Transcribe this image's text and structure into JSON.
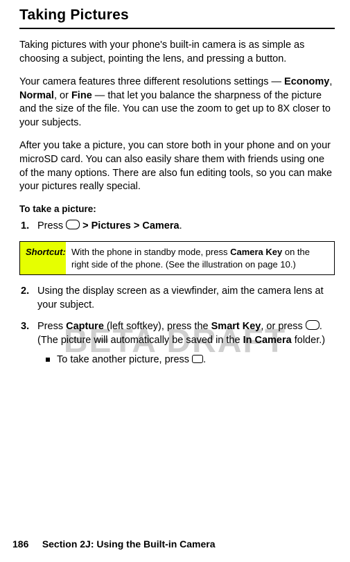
{
  "title": "Taking Pictures",
  "intro": "Taking pictures with your phone's built-in camera is as simple as choosing a subject, pointing the lens, and pressing a button.",
  "resolutions": {
    "lead": "Your camera features three different resolutions settings — ",
    "opt1": "Economy",
    "sep1": ", ",
    "opt2": "Normal",
    "sep2": ", or ",
    "opt3": "Fine",
    "tail": " — that let you balance the sharpness of the picture and the size of the file. You can use the zoom to get up to 8X closer to your subjects."
  },
  "storage": "After you take a picture, you can store both in your phone and on your microSD card. You can also easily share them with friends using one of the many options. There are also fun editing tools, so you can make your pictures really special.",
  "subhead": "To take a picture:",
  "steps": {
    "s1": {
      "num": "1.",
      "a": "Press ",
      "b": " > Pictures > Camera",
      "c": "."
    },
    "s2": {
      "num": "2.",
      "text": "Using the display screen as a viewfinder, aim the camera lens at your subject."
    },
    "s3": {
      "num": "3.",
      "a": "Press ",
      "b": "Capture",
      "c": " (left softkey), press the ",
      "d": "Smart Key",
      "e": ", or press ",
      "f": ". (The picture will automatically be saved in the ",
      "g": "In Camera",
      "h": " folder.)"
    },
    "sub": {
      "a": "To take another picture, press ",
      "b": "."
    }
  },
  "shortcut": {
    "label": "Shortcut:",
    "a": "With the phone in standby mode, press ",
    "b": "Camera Key",
    "c": " on the right side of the phone. (See the illustration on page 10.)"
  },
  "watermark": "BETA DRAFT",
  "footer": {
    "page": "186",
    "section": "Section 2J: Using the Built-in Camera"
  }
}
